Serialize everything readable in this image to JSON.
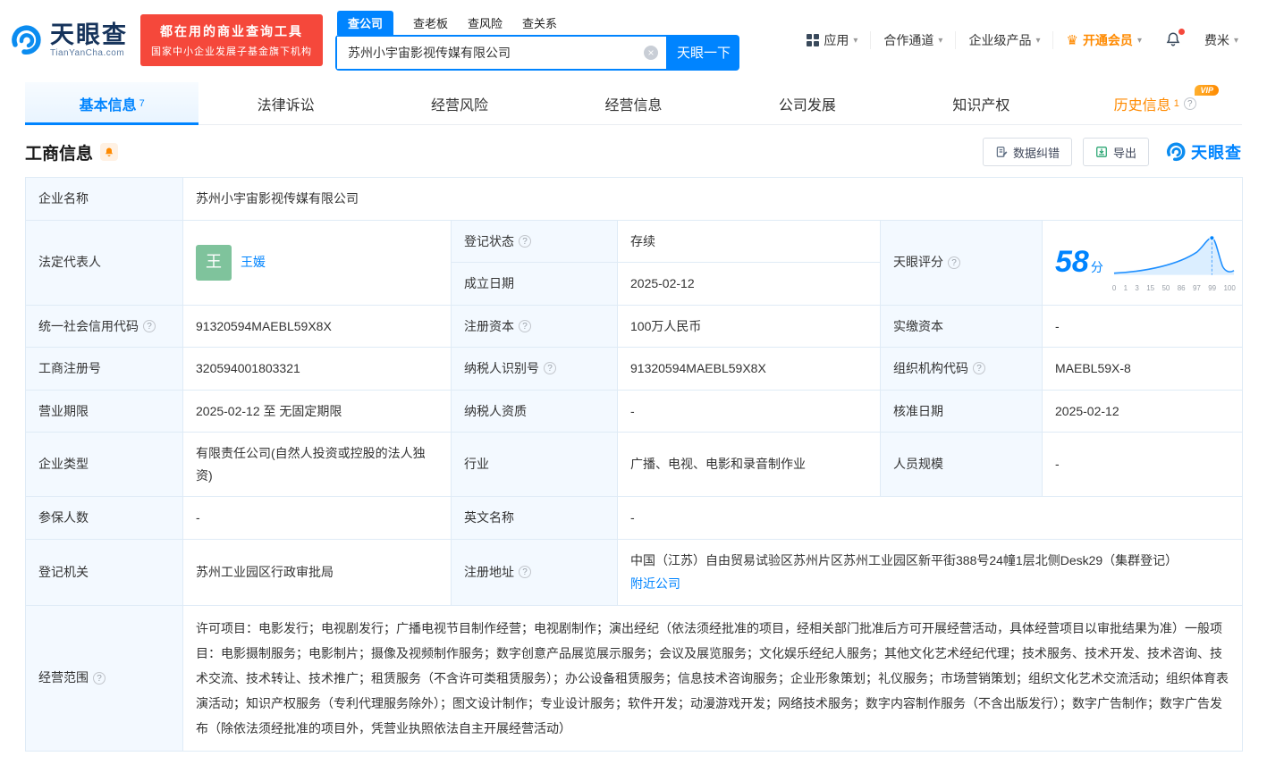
{
  "colors": {
    "accent": "#0084ff",
    "vip_orange": "#ff8a00",
    "status_green": "#00a854",
    "promo_red": "#f5483b"
  },
  "icons": {
    "help": "?",
    "caret": "▾",
    "clear": "×",
    "crown": "♛"
  },
  "header": {
    "logo": {
      "name": "天眼查",
      "domain": "TianYanCha.com"
    },
    "promo": {
      "line1": "都在用的商业查询工具",
      "line2": "国家中小企业发展子基金旗下机构"
    },
    "search": {
      "tabs": [
        {
          "label": "查公司"
        },
        {
          "label": "查老板"
        },
        {
          "label": "查风险"
        },
        {
          "label": "查关系"
        }
      ],
      "value": "苏州小宇宙影视传媒有限公司",
      "button": "天眼一下"
    },
    "menu": {
      "apps": "应用",
      "partner": "合作通道",
      "enterprise": "企业级产品",
      "vip": "开通会员",
      "user": "费米"
    }
  },
  "nav": {
    "tabs": [
      {
        "label": "基本信息",
        "count": "7"
      },
      {
        "label": "法律诉讼"
      },
      {
        "label": "经营风险"
      },
      {
        "label": "经营信息"
      },
      {
        "label": "公司发展"
      },
      {
        "label": "知识产权"
      },
      {
        "label": "历史信息",
        "count": "1",
        "badge": "VIP"
      }
    ]
  },
  "section": {
    "title": "工商信息",
    "correction": "数据纠错",
    "export": "导出",
    "brand": "天眼查"
  },
  "score": {
    "value": "58",
    "unit": "分",
    "axis": [
      "0",
      "1",
      "3",
      "15",
      "50",
      "86",
      "97",
      "99",
      "100"
    ]
  },
  "info": {
    "company_name": {
      "label": "企业名称",
      "value": "苏州小宇宙影视传媒有限公司"
    },
    "legal_rep": {
      "label": "法定代表人",
      "value": "王媛",
      "avatar_text": "王"
    },
    "reg_status": {
      "label": "登记状态",
      "value": "存续"
    },
    "establish_date": {
      "label": "成立日期",
      "value": "2025-02-12"
    },
    "tianyan_score": {
      "label": "天眼评分"
    },
    "credit_code": {
      "label": "统一社会信用代码",
      "value": "91320594MAEBL59X8X"
    },
    "reg_capital": {
      "label": "注册资本",
      "value": "100万人民币"
    },
    "paid_capital": {
      "label": "实缴资本",
      "value": "-"
    },
    "reg_number": {
      "label": "工商注册号",
      "value": "320594001803321"
    },
    "taxpayer_id": {
      "label": "纳税人识别号",
      "value": "91320594MAEBL59X8X"
    },
    "org_code": {
      "label": "组织机构代码",
      "value": "MAEBL59X-8"
    },
    "business_term": {
      "label": "营业期限",
      "value": "2025-02-12 至 无固定期限"
    },
    "taxpayer_qualification": {
      "label": "纳税人资质",
      "value": "-"
    },
    "approval_date": {
      "label": "核准日期",
      "value": "2025-02-12"
    },
    "company_type": {
      "label": "企业类型",
      "value": "有限责任公司(自然人投资或控股的法人独资)"
    },
    "industry": {
      "label": "行业",
      "value": "广播、电视、电影和录音制作业"
    },
    "staff_size": {
      "label": "人员规模",
      "value": "-"
    },
    "insured_count": {
      "label": "参保人数",
      "value": "-"
    },
    "english_name": {
      "label": "英文名称",
      "value": "-"
    },
    "reg_authority": {
      "label": "登记机关",
      "value": "苏州工业园区行政审批局"
    },
    "reg_address": {
      "label": "注册地址",
      "value": "中国（江苏）自由贸易试验区苏州片区苏州工业园区新平街388号24幢1层北侧Desk29（集群登记）",
      "link": "附近公司"
    },
    "business_scope": {
      "label": "经营范围",
      "value": "许可项目：电影发行；电视剧发行；广播电视节目制作经营；电视剧制作；演出经纪（依法须经批准的项目，经相关部门批准后方可开展经营活动，具体经营项目以审批结果为准）一般项目：电影摄制服务；电影制片；摄像及视频制作服务；数字创意产品展览展示服务；会议及展览服务；文化娱乐经纪人服务；其他文化艺术经纪代理；技术服务、技术开发、技术咨询、技术交流、技术转让、技术推广；租赁服务（不含许可类租赁服务）；办公设备租赁服务；信息技术咨询服务；企业形象策划；礼仪服务；市场营销策划；组织文化艺术交流活动；组织体育表演活动；知识产权服务（专利代理服务除外）；图文设计制作；专业设计服务；软件开发；动漫游戏开发；网络技术服务；数字内容制作服务（不含出版发行）；数字广告制作；数字广告发布（除依法须经批准的项目外，凭营业执照依法自主开展经营活动）"
    }
  }
}
